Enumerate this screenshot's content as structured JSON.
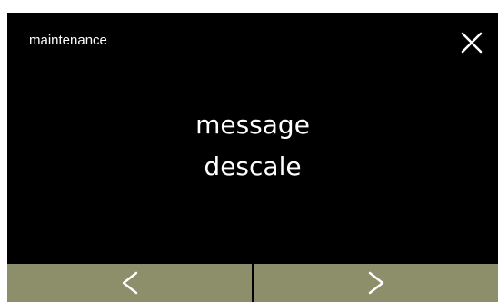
{
  "header": {
    "title": "maintenance",
    "close_icon": "close-icon"
  },
  "main": {
    "message_lines": [
      "message",
      "descale"
    ]
  },
  "nav": {
    "previous_icon": "chevron-left-icon",
    "next_icon": "chevron-right-icon",
    "button_color": "#8c8f6a"
  },
  "colors": {
    "background": "#000000",
    "text": "#ffffff"
  }
}
